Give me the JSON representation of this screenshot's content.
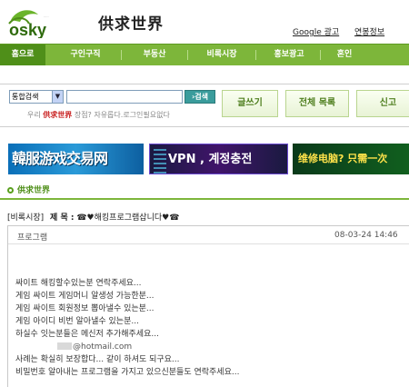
{
  "header": {
    "site_name": "供求世界",
    "google_ad_link": "Google 광고",
    "related_sites_link": "연봉정보"
  },
  "nav": {
    "items": [
      {
        "label": "홈으로"
      },
      {
        "label": "구인구직"
      },
      {
        "label": "부동산"
      },
      {
        "label": "비록시장"
      },
      {
        "label": "홍보광고"
      },
      {
        "label": "혼인"
      }
    ]
  },
  "search": {
    "select_value": "통합검색",
    "input_value": "",
    "button_label": "검색",
    "notice_prefix": "우리",
    "notice_brand": "供求世界",
    "notice_suffix": "장점? 자유롭다.로그인필요없다"
  },
  "actions": {
    "write_label": "글쓰기",
    "list_label": "전체 목록",
    "report_label": "신고"
  },
  "banners": [
    {
      "text": "韓服游戏交易网"
    },
    {
      "text": "VPN , 계정충전"
    },
    {
      "text": "维修电脑? 只需一次"
    }
  ],
  "breadcrumb": {
    "label": "供求世界"
  },
  "post": {
    "category": "[비록시장]",
    "title_label": "제 목 :",
    "title": "☎♥해킹프로그램삽니다♥☎",
    "author": "프로그램",
    "date": "08-03-24 14:46",
    "lines": [
      "싸이트 해킹할수있는분 연락주세요...",
      "게임 싸이트 게임머니 알생성 가능한분...",
      "게임 싸이트 회원정보 뽑아낼수 있는분...",
      "게임 아이디 비번 알아낼수 있는분...",
      "하실수 잇는분들은 메신저 추가해주세요..."
    ],
    "email": "@hotmail.com",
    "lines_after": [
      "사례는 확실히 보장합다... 같이 하셔도 되구요...",
      "비밀번호 알아내는 프로그램을 가지고 있으신분들도 연락주세요..."
    ]
  },
  "colors": {
    "nav_green": "#7db63a",
    "nav_active": "#4f8f19",
    "brand_red": "#c81e1e"
  }
}
